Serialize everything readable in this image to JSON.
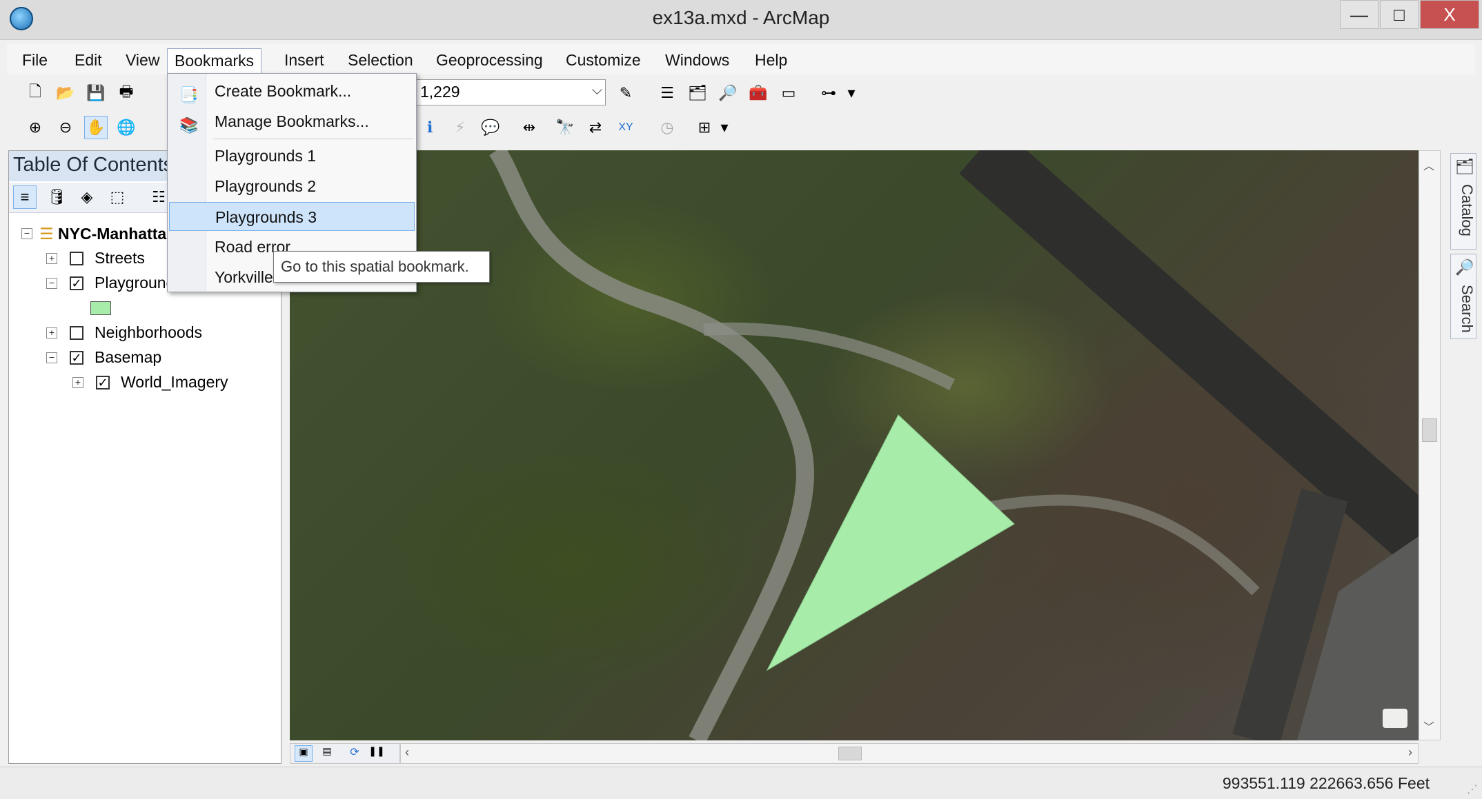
{
  "window": {
    "title": "ex13a.mxd - ArcMap",
    "minimize": "—",
    "maximize": "□",
    "close": "X"
  },
  "menubar": {
    "items": [
      "File",
      "Edit",
      "View",
      "Bookmarks",
      "Insert",
      "Selection",
      "Geoprocessing",
      "Customize",
      "Windows",
      "Help"
    ],
    "open_item": "Bookmarks"
  },
  "toolbar": {
    "scale_value": "1,229"
  },
  "bookmarks_menu": {
    "items": [
      {
        "label": "Create Bookmark...",
        "icon": "create-bookmark-icon"
      },
      {
        "label": "Manage Bookmarks...",
        "icon": "manage-bookmarks-icon"
      },
      {
        "label": "Playgrounds 1"
      },
      {
        "label": "Playgrounds 2"
      },
      {
        "label": "Playgrounds 3",
        "highlighted": true
      },
      {
        "label": "Road error"
      },
      {
        "label": "Yorkville"
      }
    ],
    "tooltip": "Go to this spatial bookmark."
  },
  "toc": {
    "title": "Table Of Contents",
    "data_frame": "NYC-Manhattan",
    "layers": [
      {
        "name": "Streets",
        "checked": false,
        "expanded": false
      },
      {
        "name": "Playgrounds",
        "checked": true,
        "expanded": true,
        "swatch_color": "#a8ecaa"
      },
      {
        "name": "Neighborhoods",
        "checked": false,
        "expanded": false
      },
      {
        "name": "Basemap",
        "checked": true,
        "expanded": true
      },
      {
        "name": "World_Imagery",
        "checked": true,
        "expanded": false
      }
    ]
  },
  "map": {
    "polygon_color": "#a8ecaa"
  },
  "side_tabs": [
    "Catalog",
    "Search"
  ],
  "status": {
    "coordinates": "993551.119  222663.656 Feet"
  }
}
